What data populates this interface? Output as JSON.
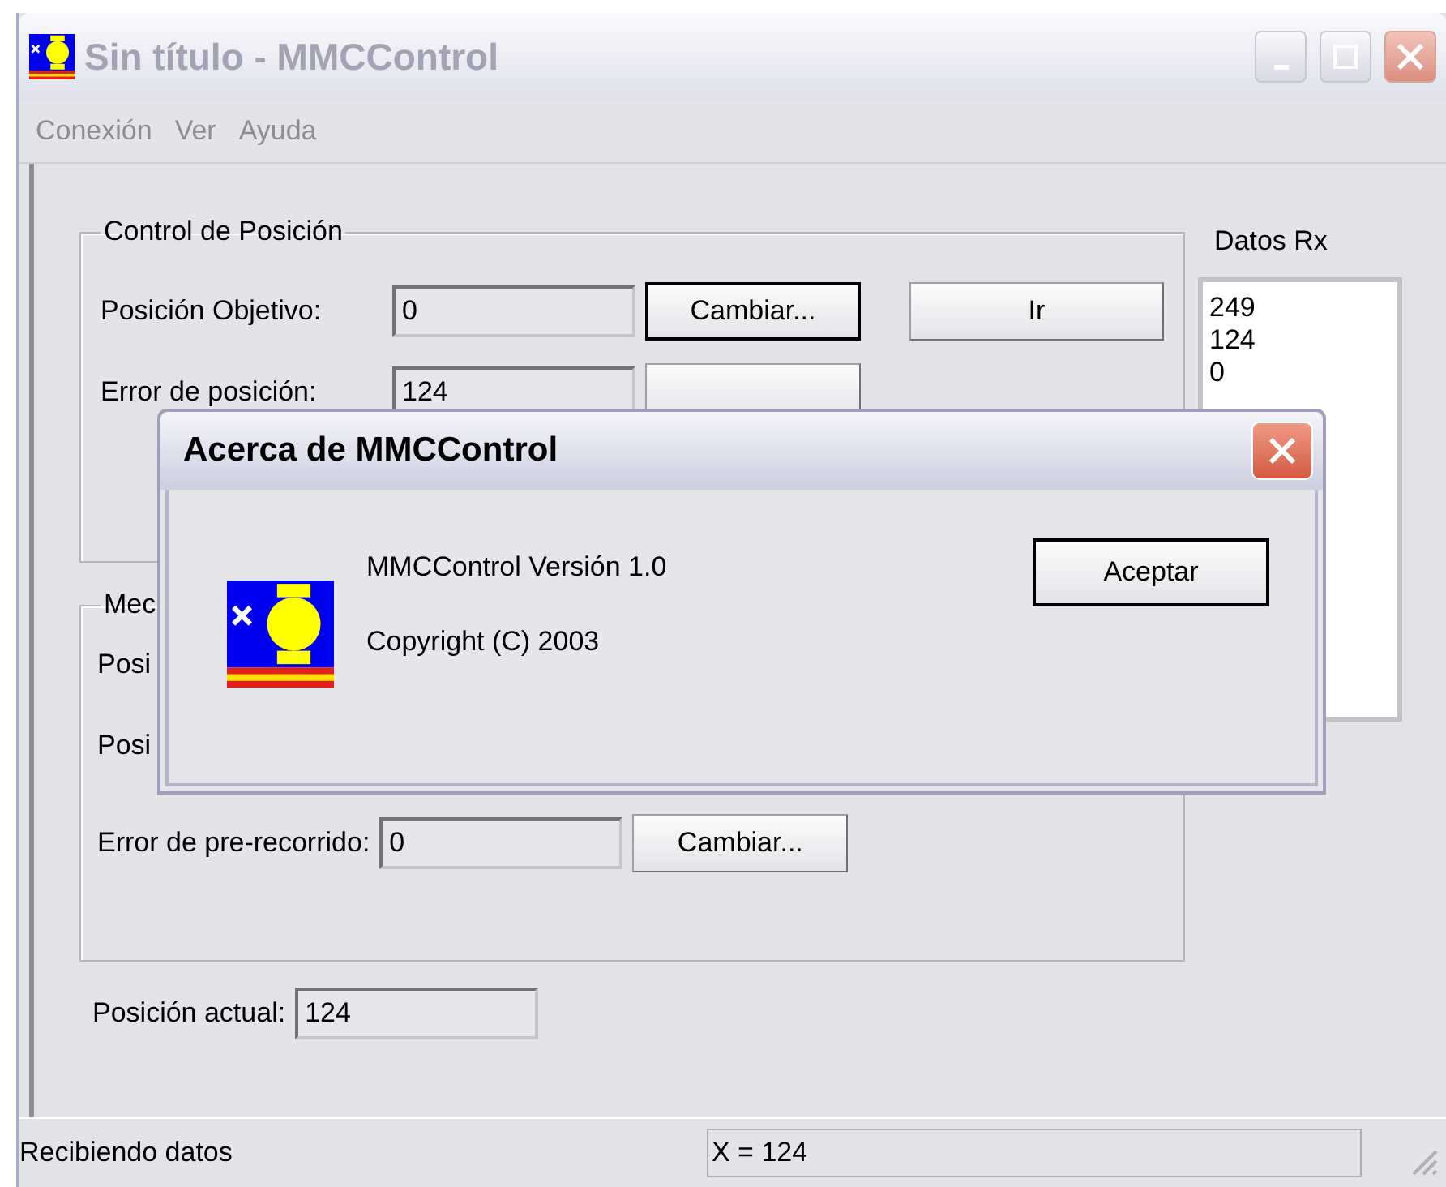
{
  "window": {
    "title": "Sin título - MMCControl"
  },
  "menu": [
    "Conexión",
    "Ver",
    "Ayuda"
  ],
  "position_control": {
    "title": "Control de Posición",
    "rows": [
      {
        "label": "Posición Objetivo:",
        "value": "0",
        "buttons": [
          {
            "label": "Cambiar...",
            "focused": true
          },
          {
            "label": "Ir",
            "focused": false
          }
        ]
      },
      {
        "label": "Error de posición:",
        "value": "124",
        "buttons": [
          {
            "focused": false
          }
        ]
      }
    ]
  },
  "second_group": {
    "title": "Mec",
    "rows": [
      {
        "label": "Posi"
      },
      {
        "label": "Posi"
      },
      {
        "label": "Error de pre-recorrido:",
        "value": "0",
        "buttons": [
          {
            "label": "Cambiar...",
            "focused": false
          }
        ]
      }
    ]
  },
  "current_position": {
    "label": "Posición actual:",
    "value": "124"
  },
  "rx_data": {
    "title": "Datos Rx",
    "items": [
      "249",
      "124",
      "0"
    ]
  },
  "dialog": {
    "title": "Acerca de MMCControl",
    "lines": [
      "MMCControl Versión 1.0",
      "Copyright (C) 2003"
    ],
    "button": "Aceptar"
  },
  "status_bar": {
    "message": "Recibiendo datos",
    "position": "X = 124"
  }
}
